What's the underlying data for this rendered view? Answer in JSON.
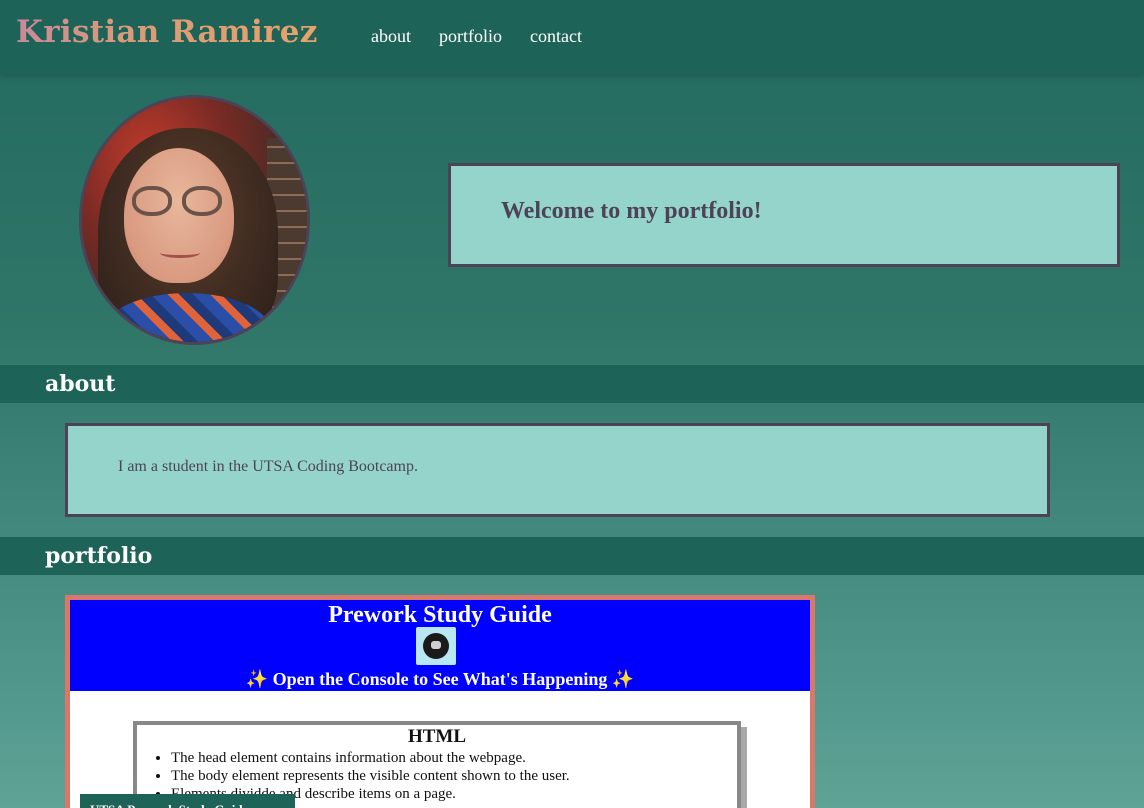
{
  "header": {
    "site_name": "Kristian Ramirez",
    "nav": [
      {
        "label": "about"
      },
      {
        "label": "portfolio"
      },
      {
        "label": "contact"
      }
    ]
  },
  "hero": {
    "welcome": "Welcome to my portfolio!"
  },
  "about": {
    "heading": "about",
    "text": "I am a student in the UTSA Coding Bootcamp."
  },
  "portfolio": {
    "heading": "portfolio",
    "project": {
      "banner_title": "Prework Study Guide",
      "banner_subtitle": "✨ Open the Console to See What's Happening ✨",
      "card_title": "HTML",
      "card_items": [
        "The head element contains information about the webpage.",
        "The body element represents the visible content shown to the user.",
        "Elements dividde and describe items on a page."
      ],
      "caption": "UTSA Prework Study Guide"
    }
  },
  "colors": {
    "header_bg": "#1d6358",
    "box_bg": "#95d4cb",
    "box_border": "#4d4357",
    "project_border": "#d9776a"
  }
}
